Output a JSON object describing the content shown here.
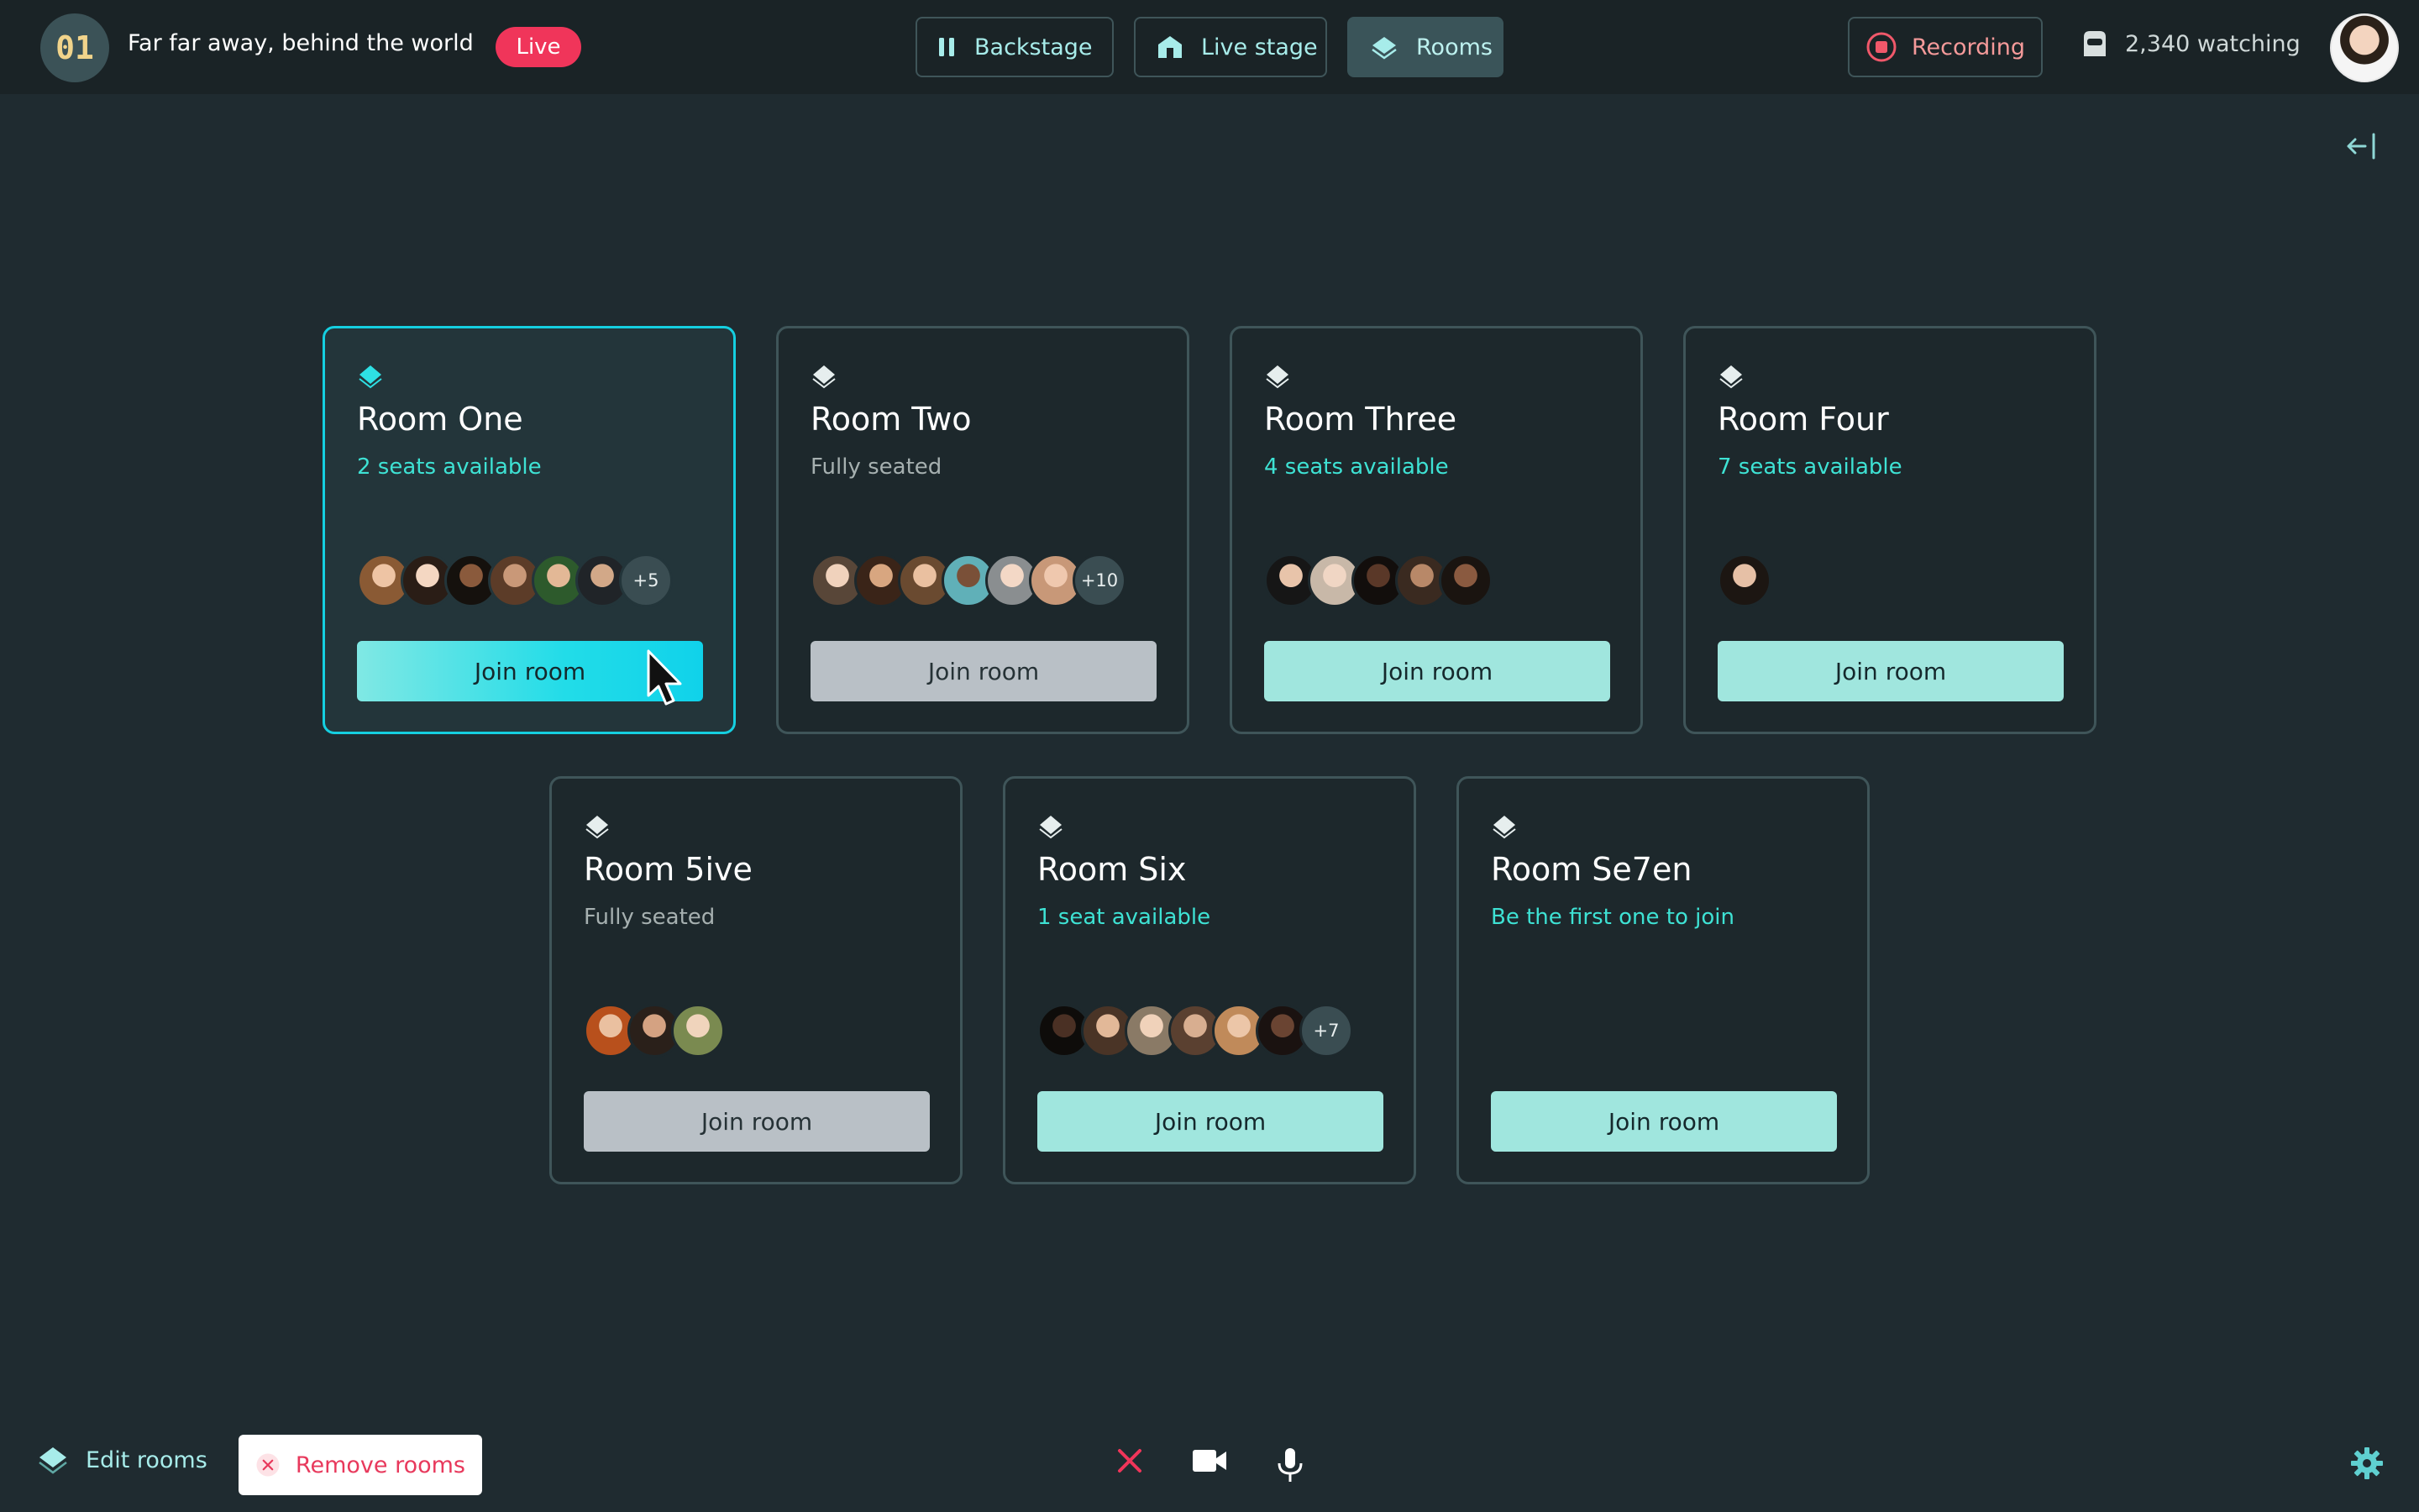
{
  "header": {
    "badge": "01",
    "event_title": "Far far away, behind the world",
    "live_label": "Live",
    "nav": [
      {
        "label": "Backstage",
        "icon": "pause-icon",
        "active": false
      },
      {
        "label": "Live stage",
        "icon": "home-icon",
        "active": false
      },
      {
        "label": "Rooms",
        "icon": "layers-icon",
        "active": true
      }
    ],
    "recording_label": "Recording",
    "watching_label": "2,340 watching"
  },
  "rooms": [
    {
      "name": "Room One",
      "status": "2 seats available",
      "more": "+5",
      "join_label": "Join room",
      "state": "selected"
    },
    {
      "name": "Room Two",
      "status": "Fully seated",
      "more": "+10",
      "join_label": "Join room",
      "state": "full"
    },
    {
      "name": "Room Three",
      "status": "4 seats available",
      "more": "",
      "join_label": "Join room",
      "state": "available"
    },
    {
      "name": "Room Four",
      "status": "7 seats available",
      "more": "",
      "join_label": "Join room",
      "state": "available"
    },
    {
      "name": "Room 5ive",
      "status": "Fully seated",
      "more": "",
      "join_label": "Join room",
      "state": "full"
    },
    {
      "name": "Room Six",
      "status": "1 seat available",
      "more": "+7",
      "join_label": "Join room",
      "state": "available"
    },
    {
      "name": "Room Se7en",
      "status": "Be the first one to join",
      "more": "",
      "join_label": "Join room",
      "state": "available"
    }
  ],
  "footer": {
    "edit_rooms_label": "Edit rooms",
    "remove_rooms_label": "Remove rooms"
  },
  "colors": {
    "accent": "#3ee2d4",
    "live": "#f0355a",
    "recording": "#f59a9a",
    "join_button": "#a0e6de",
    "join_disabled": "#b9c0c6"
  }
}
